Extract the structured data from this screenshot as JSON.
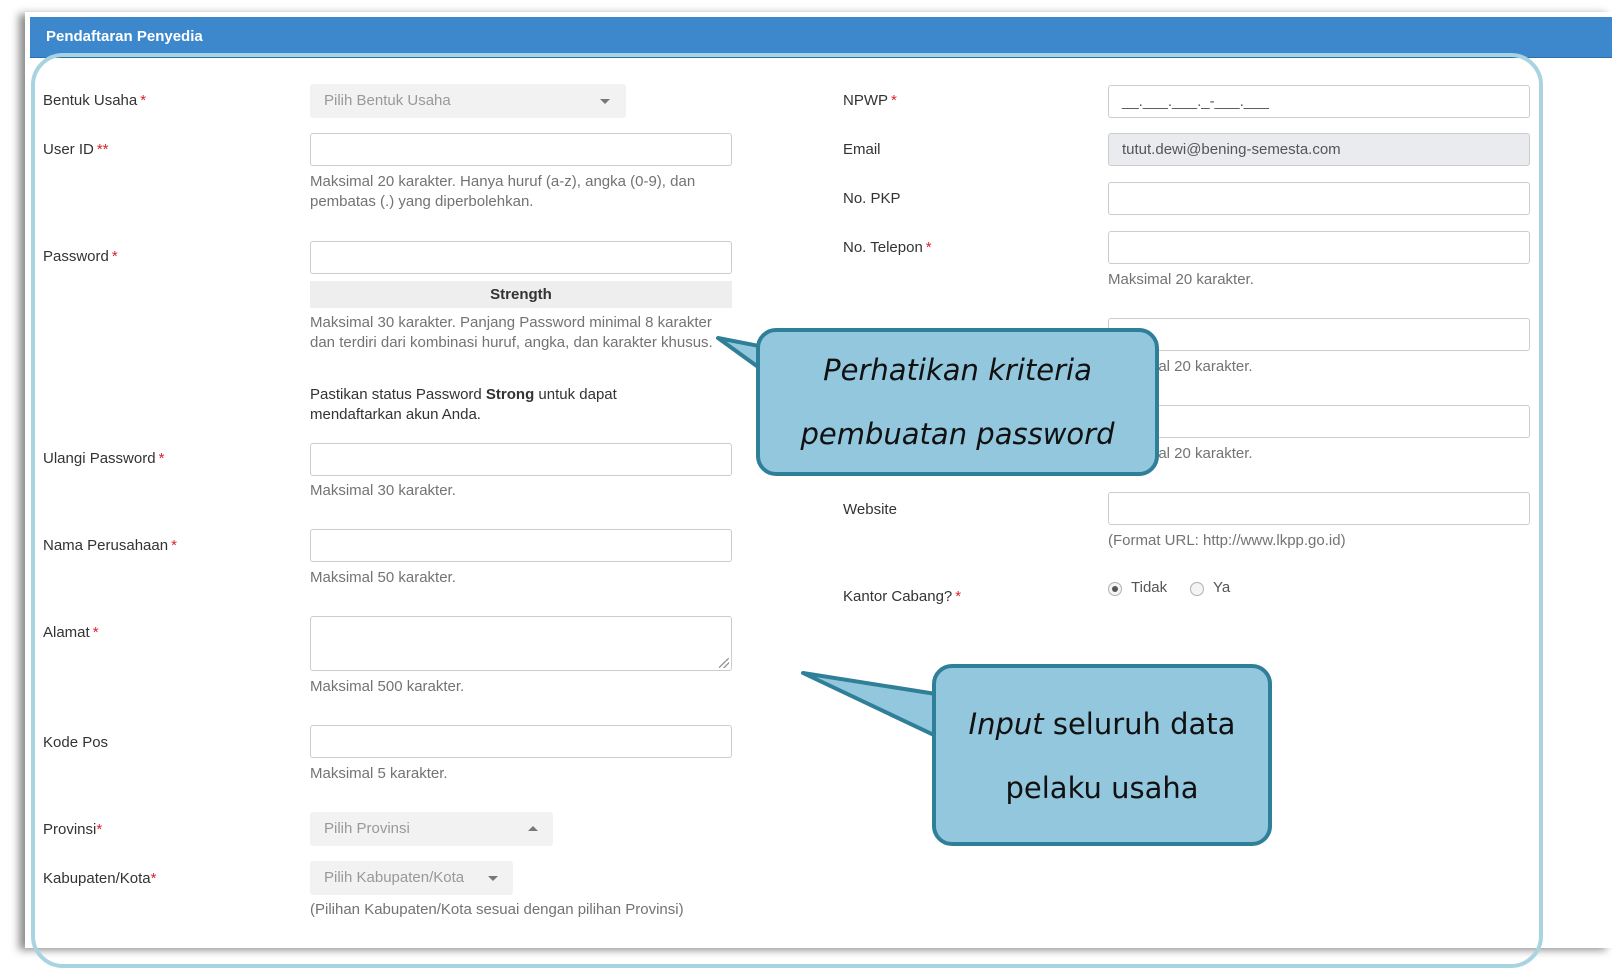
{
  "panel": {
    "title": "Pendaftaran Penyedia"
  },
  "left": {
    "bentuk_usaha": {
      "label": "Bentuk Usaha",
      "required": "*",
      "placeholder": "Pilih Bentuk Usaha"
    },
    "user_id": {
      "label": "User ID",
      "required": "**",
      "help": "Maksimal 20 karakter. Hanya huruf (a-z), angka (0-9), dan pembatas (.) yang diperbolehkan."
    },
    "password": {
      "label": "Password",
      "required": "*",
      "strength": "Strength",
      "help": "Maksimal 30 karakter. Panjang Password minimal 8 karakter dan terdiri dari kombinasi huruf, angka, dan karakter khusus.",
      "note_pre": "Pastikan status Password ",
      "note_strong": "Strong",
      "note_post": " untuk dapat mendaftarkan akun Anda."
    },
    "ulangi_password": {
      "label": "Ulangi Password",
      "required": "*",
      "help": "Maksimal 30 karakter."
    },
    "nama_perusahaan": {
      "label": "Nama Perusahaan",
      "required": "*",
      "help": "Maksimal 50 karakter."
    },
    "alamat": {
      "label": "Alamat",
      "required": "*",
      "help": "Maksimal 500 karakter."
    },
    "kode_pos": {
      "label": "Kode Pos",
      "help": "Maksimal 5 karakter."
    },
    "provinsi": {
      "label": "Provinsi",
      "required": "*",
      "placeholder": "Pilih Provinsi"
    },
    "kabupaten": {
      "label": "Kabupaten/Kota",
      "required": "*",
      "placeholder": "Pilih Kabupaten/Kota",
      "help": "(Pilihan Kabupaten/Kota sesuai dengan pilihan Provinsi)"
    }
  },
  "right": {
    "npwp": {
      "label": "NPWP",
      "required": "*",
      "mask": "__.___.___._-___.___"
    },
    "email": {
      "label": "Email",
      "value": "tutut.dewi@bening-semesta.com"
    },
    "no_pkp": {
      "label": "No. PKP"
    },
    "no_telepon": {
      "label": "No. Telepon",
      "required": "*",
      "help": "Maksimal 20 karakter."
    },
    "field_a": {
      "help_partial": "nal 20 karakter."
    },
    "field_b": {
      "help_partial": "nal 20 karakter."
    },
    "website": {
      "label": "Website",
      "help": "(Format URL: http://www.lkpp.go.id)"
    },
    "kantor_cabang": {
      "label": "Kantor Cabang?",
      "required": "*",
      "option_tidak": "Tidak",
      "option_ya": "Ya",
      "selected": "Tidak"
    }
  },
  "callouts": {
    "password_line1": "Perhatikan kriteria",
    "password_line2": "pembuatan password",
    "input_line1_italic": "Input",
    "input_line1_rest": " seluruh data",
    "input_line2": "pelaku usaha"
  },
  "colors": {
    "header_bg": "#3d88cc",
    "required": "#d9232d",
    "callout_fill": "#92c7dd",
    "callout_border": "#2f7f98",
    "outline": "#a8d3e0"
  }
}
